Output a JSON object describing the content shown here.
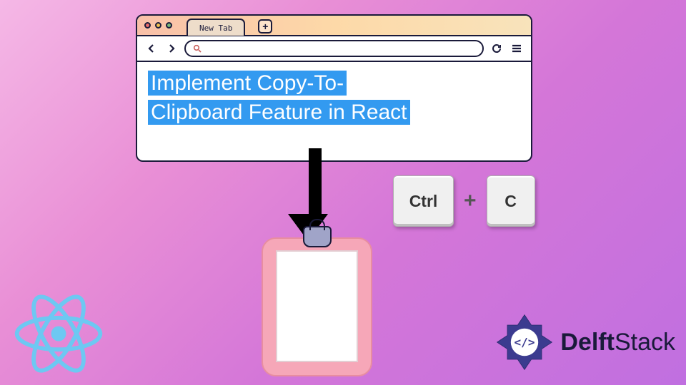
{
  "browser": {
    "tab_label": "New Tab",
    "content_line1": "Implement Copy-To-",
    "content_line2": "Clipboard Feature in React"
  },
  "shortcut": {
    "key1": "Ctrl",
    "separator": "+",
    "key2": "C"
  },
  "brand": {
    "name_bold": "Delft",
    "name_light": "Stack"
  },
  "icons": {
    "back": "chevron-left",
    "forward": "chevron-right",
    "search": "magnifier",
    "refresh": "refresh",
    "menu": "hamburger",
    "newtab": "plus"
  }
}
